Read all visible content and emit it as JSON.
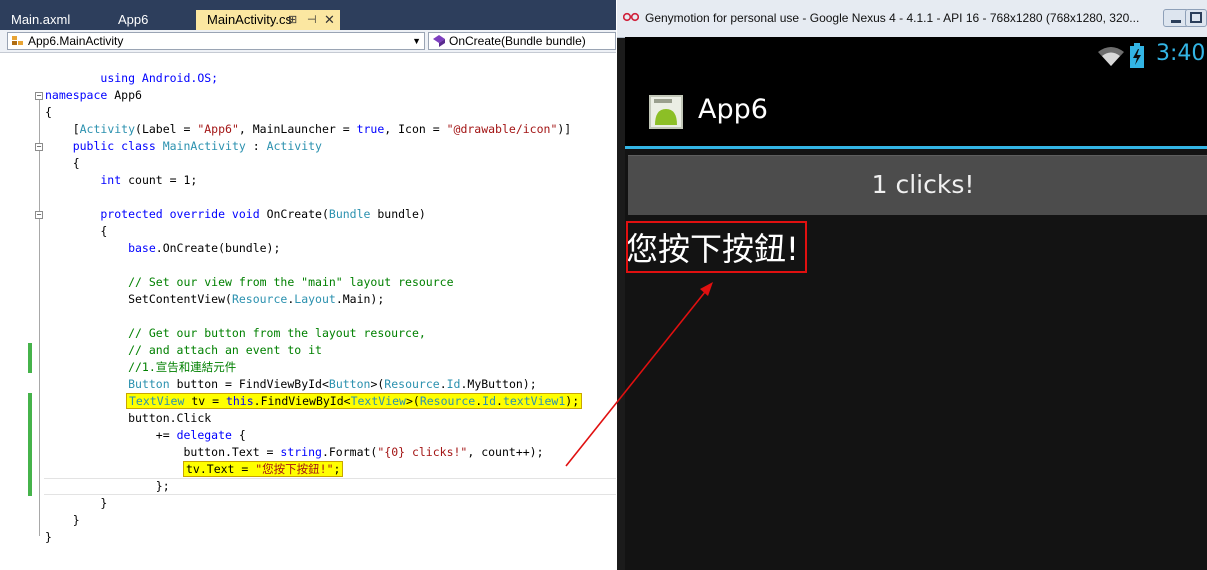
{
  "vs": {
    "tabs": [
      {
        "label": "Main.axml",
        "active": false
      },
      {
        "label": "App6",
        "active": false
      },
      {
        "label": "MainActivity.cs",
        "active": true
      }
    ],
    "nav": {
      "type_combo": "App6.MainActivity",
      "member_combo": "OnCreate(Bundle bundle)"
    },
    "code": {
      "l1": "using Android.OS;",
      "l2a": "namespace",
      "l2b": " App6",
      "l3": "{",
      "l4a": "    [",
      "l4b": "Activity",
      "l4c": "(Label = ",
      "l4d": "\"App6\"",
      "l4e": ", MainLauncher = ",
      "l4f": "true",
      "l4g": ", Icon = ",
      "l4h": "\"@drawable/icon\"",
      "l4i": ")]",
      "l5a": "    public class ",
      "l5b": "MainActivity",
      "l5c": " : ",
      "l5d": "Activity",
      "l6": "    {",
      "l7a": "        int",
      "l7b": " count = 1;",
      "l8a": "        protected override void",
      "l8b": " OnCreate(",
      "l8c": "Bundle",
      "l8d": " bundle)",
      "l9": "        {",
      "l10a": "            base",
      "l10b": ".OnCreate(bundle);",
      "l11": "            // Set our view from the \"main\" layout resource",
      "l12a": "            SetContentView(",
      "l12b": "Resource",
      "l12c": ".",
      "l12d": "Layout",
      "l12e": ".Main);",
      "l13": "            // Get our button from the layout resource,",
      "l14": "            // and attach an event to it",
      "l15": "            //1.宣告和連結元件",
      "l16a": "            ",
      "l16b": "Button",
      "l16c": " button = FindViewById<",
      "l16d": "Button",
      "l16e": ">(",
      "l16f": "Resource",
      "l16g": ".",
      "l16h": "Id",
      "l16i": ".MyButton);",
      "l17a": "TextView",
      "l17b": " tv = ",
      "l17c": "this",
      "l17d": ".FindViewById<",
      "l17e": "TextView",
      "l17f": ">(",
      "l17g": "Resource",
      "l17h": ".",
      "l17i": "Id",
      "l17j": ".",
      "l17k": "textView1",
      "l17l": ");",
      "l18": "            button.Click",
      "l19a": "                += ",
      "l19b": "delegate",
      "l19c": " {",
      "l20a": "                    button.Text = ",
      "l20b": "string",
      "l20c": ".Format(",
      "l20d": "\"{0} clicks!\"",
      "l20e": ", count++);",
      "l21a": "tv.Text = ",
      "l21b": "\"您按下按鈕!\"",
      "l21c": ";",
      "l22": "                };",
      "l23": "        }",
      "l24": "    }",
      "l25": "}"
    }
  },
  "genymotion": {
    "window_title": "Genymotion for personal use - Google Nexus 4 - 4.1.1 - API 16 - 768x1280 (768x1280, 320...",
    "status_time": "3:40",
    "app_title": "App6",
    "button_text": "1 clicks!",
    "textview_text": "您按下按鈕!"
  },
  "colors": {
    "vs_tab_bar": "#2d3e5c",
    "vs_active_tab": "#fbe7a1",
    "holo_blue": "#33b5e5",
    "highlight": "#ffff00",
    "annotation_red": "#e01010"
  }
}
